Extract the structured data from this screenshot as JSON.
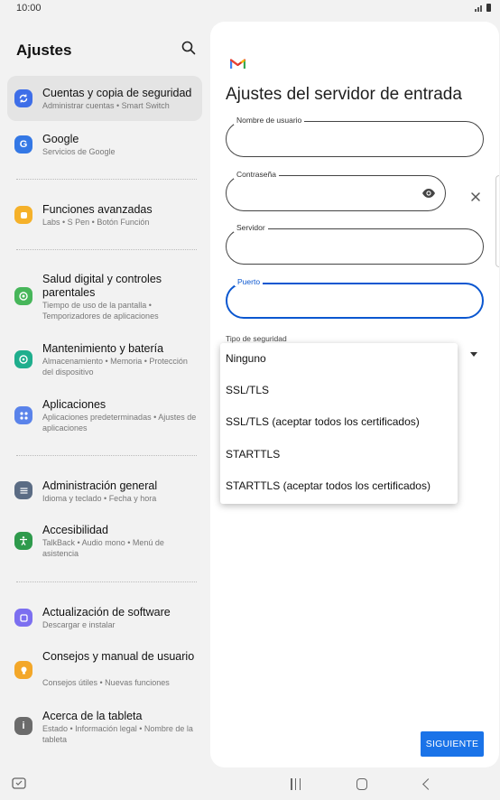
{
  "status": {
    "time": "10:00"
  },
  "settings": {
    "title": "Ajustes",
    "items": [
      {
        "title": "Cuentas y copia de seguridad",
        "subtitle": "Administrar cuentas • Smart Switch",
        "icon": "sync-icon",
        "color": "#3e6ee8",
        "selected": true
      },
      {
        "title": "Google",
        "subtitle": "Servicios de Google",
        "icon": "google-icon",
        "color": "#3478e5"
      },
      {
        "title": "Funciones avanzadas",
        "subtitle": "Labs • S Pen • Botón Función",
        "icon": "puzzle-icon",
        "color": "#f5b12a"
      },
      {
        "title": "Salud digital y controles parentales",
        "subtitle": "Tiempo de uso de la pantalla • Temporizadores de aplicaciones",
        "icon": "wellbeing-icon",
        "color": "#47b65a"
      },
      {
        "title": "Mantenimiento y batería",
        "subtitle": "Almacenamiento • Memoria • Protección del dispositivo",
        "icon": "care-icon",
        "color": "#1fae8d"
      },
      {
        "title": "Aplicaciones",
        "subtitle": "Aplicaciones predeterminadas • Ajustes de aplicaciones",
        "icon": "apps-icon",
        "color": "#5a83ea"
      },
      {
        "title": "Administración general",
        "subtitle": "Idioma y teclado • Fecha y hora",
        "icon": "sliders-icon",
        "color": "#5b6c84"
      },
      {
        "title": "Accesibilidad",
        "subtitle": "TalkBack • Audio mono • Menú de asistencia",
        "icon": "accessibility-icon",
        "color": "#2e9a4c"
      },
      {
        "title": "Actualización de software",
        "subtitle": "Descargar e instalar",
        "icon": "update-icon",
        "color": "#7c6ff0"
      },
      {
        "title": "Consejos y manual de usuario",
        "subtitle": "Consejos útiles • Nuevas funciones",
        "icon": "bulb-icon",
        "color": "#f3a729"
      },
      {
        "title": "Acerca de la tableta",
        "subtitle": "Estado • Información legal • Nombre de la tableta",
        "icon": "info-icon",
        "color": "#6b6b6b"
      }
    ]
  },
  "form": {
    "title": "Ajustes del servidor de entrada",
    "username_label": "Nombre de usuario",
    "password_label": "Contraseña",
    "server_label": "Servidor",
    "port_label": "Puerto",
    "security_label": "Tipo de seguridad",
    "security_options": [
      "Ninguno",
      "SSL/TLS",
      "SSL/TLS (aceptar todos los certificados)",
      "STARTTLS",
      "STARTTLS (aceptar todos los certificados)"
    ],
    "next_label": "SIGUIENTE",
    "accent_color": "#0b57d0"
  }
}
